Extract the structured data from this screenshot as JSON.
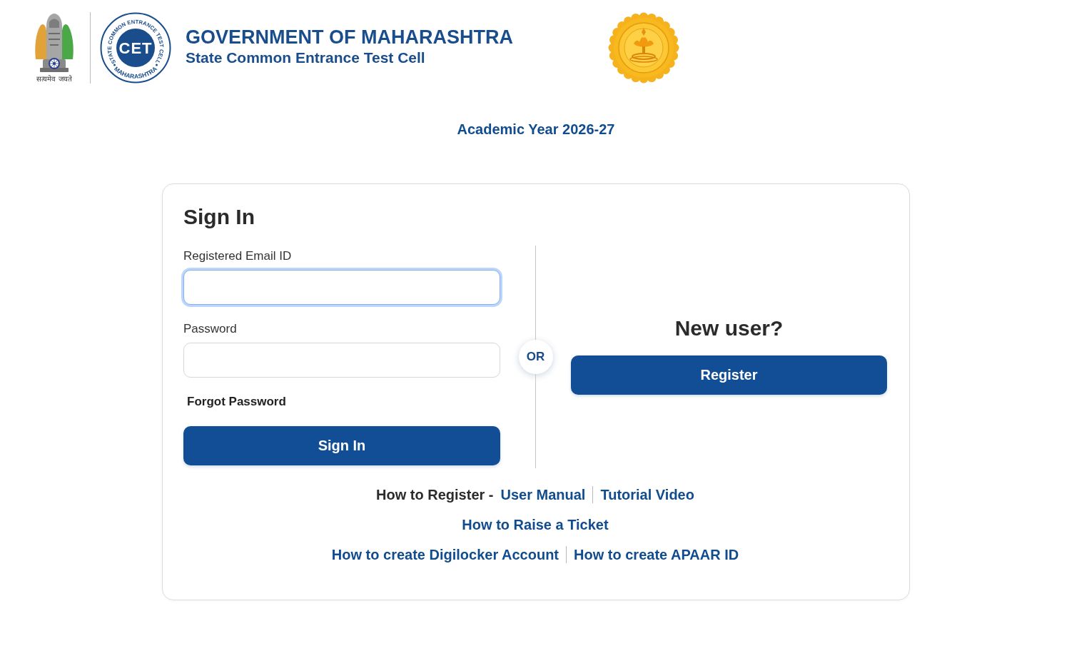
{
  "header": {
    "emblem": {
      "motto": "सत्यमेव जयते"
    },
    "cet_logo": {
      "mark": "CET",
      "ring_text": "STATE COMMON ENTRANCE TEST CELL",
      "bottom_text": "MAHARASHTRA"
    },
    "title": "GOVERNMENT OF MAHARASHTRA",
    "subtitle": "State Common Entrance Test Cell"
  },
  "academic_year": "Academic Year 2026-27",
  "sign_in": {
    "heading": "Sign In",
    "fields": [
      {
        "label": "Registered Email ID",
        "focused": true
      },
      {
        "label": "Password",
        "focused": false
      }
    ],
    "forgot_link": "Forgot Password",
    "button": "Sign In"
  },
  "divider": {
    "label": "OR"
  },
  "new_user": {
    "heading": "New user?",
    "button": "Register"
  },
  "help": [
    {
      "items": [
        {
          "kind": "text",
          "text": "How to Register -"
        },
        {
          "kind": "link",
          "text": "User Manual"
        },
        {
          "kind": "link",
          "text": "Tutorial Video"
        }
      ]
    },
    {
      "items": [
        {
          "kind": "link",
          "text": "How to Raise a Ticket"
        }
      ]
    },
    {
      "items": [
        {
          "kind": "link",
          "text": "How to create Digilocker Account"
        },
        {
          "kind": "link",
          "text": "How to create APAAR ID"
        }
      ]
    }
  ]
}
